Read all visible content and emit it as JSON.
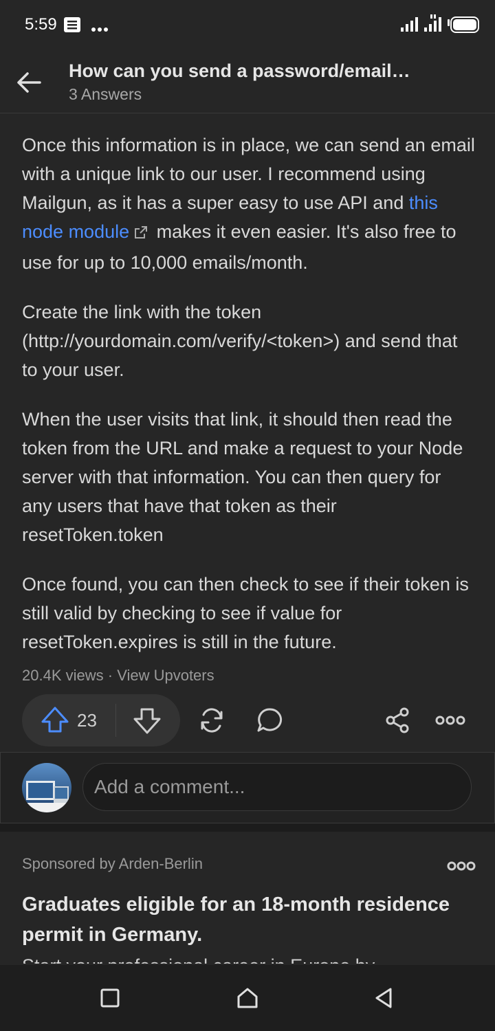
{
  "status_bar": {
    "time": "5:59",
    "icons": [
      "notification-icon",
      "more-dots-icon",
      "signal-icon",
      "signal-icon",
      "battery-icon"
    ]
  },
  "header": {
    "title": "How can you send a password/email…",
    "subtitle": "3 Answers"
  },
  "answer": {
    "p1_before": "Once this information is in place, we can send an email with a unique link to our user. I recommend using Mailgun, as it has a super easy to use API and ",
    "p1_link": "this node module",
    "p1_after": " makes it even easier. It's also free to use for up to 10,000 emails/month.",
    "p2": "Create the link with the token (http://yourdomain.com/verify/<token>) and send that to your user.",
    "p3": "When the user visits that link, it should then read the token from the URL and make a request to your Node server with that information. You can then query for any users that have that token as their resetToken.token",
    "p4": "Once found, you can then check to see if their token is still valid by checking to see if value for resetToken.expires is still in the future."
  },
  "meta": {
    "views": "20.4K views",
    "separator": " · ",
    "upvoters": "View Upvoters"
  },
  "actions": {
    "upvotes": "23"
  },
  "comment": {
    "placeholder": "Add a comment..."
  },
  "sponsored": {
    "label": "Sponsored by Arden-Berlin",
    "title": "Graduates eligible for an 18-month residence permit in Germany.",
    "body_cut": "Start your professional career in Europe by"
  },
  "colors": {
    "background": "#262626",
    "link": "#4c8dff",
    "upvote": "#4c8dff"
  }
}
